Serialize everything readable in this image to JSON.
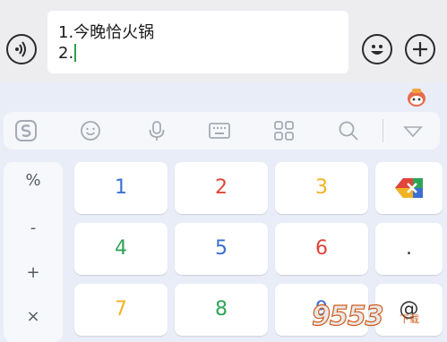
{
  "message": {
    "line1": "1.今晚恰火锅",
    "line2": "2."
  },
  "toolbar": {
    "icons": [
      "sogou-logo-icon",
      "emoji-icon",
      "microphone-icon",
      "keyboard-icon",
      "apps-grid-icon",
      "search-icon",
      "collapse-icon"
    ]
  },
  "side_panel": {
    "symbols": [
      "%",
      "-",
      "+",
      "×"
    ]
  },
  "keys": {
    "row1": [
      "1",
      "2",
      "3"
    ],
    "row2": [
      "4",
      "5",
      "6"
    ],
    "row3": [
      "7",
      "8",
      "9"
    ],
    "dot": ".",
    "at": "@"
  },
  "key_colors": {
    "1": "#3b6fd1",
    "2": "#e0443a",
    "3": "#f0b323",
    "4": "#2fa457",
    "5": "#3b6fd1",
    "6": "#e0443a",
    "7": "#f0b323",
    "8": "#2fa457",
    "9": "#3b6fd1"
  },
  "watermark": {
    "text": "9553",
    "sub": "下载"
  }
}
